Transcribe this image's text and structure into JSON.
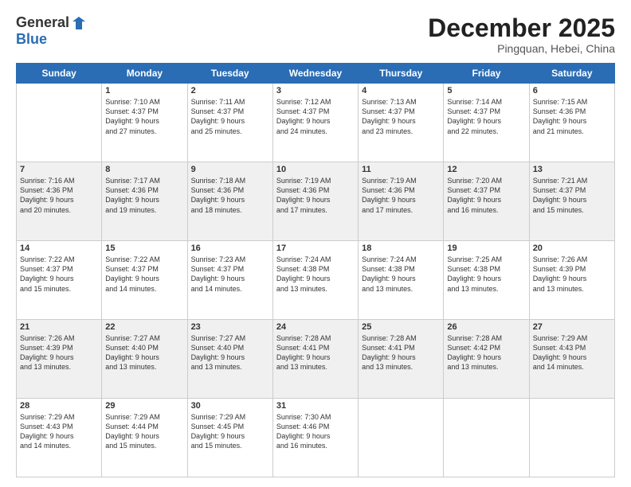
{
  "logo": {
    "general": "General",
    "blue": "Blue"
  },
  "header": {
    "month": "December 2025",
    "location": "Pingquan, Hebei, China"
  },
  "days_of_week": [
    "Sunday",
    "Monday",
    "Tuesday",
    "Wednesday",
    "Thursday",
    "Friday",
    "Saturday"
  ],
  "weeks": [
    [
      {
        "day": "",
        "content": ""
      },
      {
        "day": "1",
        "content": "Sunrise: 7:10 AM\nSunset: 4:37 PM\nDaylight: 9 hours\nand 27 minutes."
      },
      {
        "day": "2",
        "content": "Sunrise: 7:11 AM\nSunset: 4:37 PM\nDaylight: 9 hours\nand 25 minutes."
      },
      {
        "day": "3",
        "content": "Sunrise: 7:12 AM\nSunset: 4:37 PM\nDaylight: 9 hours\nand 24 minutes."
      },
      {
        "day": "4",
        "content": "Sunrise: 7:13 AM\nSunset: 4:37 PM\nDaylight: 9 hours\nand 23 minutes."
      },
      {
        "day": "5",
        "content": "Sunrise: 7:14 AM\nSunset: 4:37 PM\nDaylight: 9 hours\nand 22 minutes."
      },
      {
        "day": "6",
        "content": "Sunrise: 7:15 AM\nSunset: 4:36 PM\nDaylight: 9 hours\nand 21 minutes."
      }
    ],
    [
      {
        "day": "7",
        "content": "Sunrise: 7:16 AM\nSunset: 4:36 PM\nDaylight: 9 hours\nand 20 minutes."
      },
      {
        "day": "8",
        "content": "Sunrise: 7:17 AM\nSunset: 4:36 PM\nDaylight: 9 hours\nand 19 minutes."
      },
      {
        "day": "9",
        "content": "Sunrise: 7:18 AM\nSunset: 4:36 PM\nDaylight: 9 hours\nand 18 minutes."
      },
      {
        "day": "10",
        "content": "Sunrise: 7:19 AM\nSunset: 4:36 PM\nDaylight: 9 hours\nand 17 minutes."
      },
      {
        "day": "11",
        "content": "Sunrise: 7:19 AM\nSunset: 4:36 PM\nDaylight: 9 hours\nand 17 minutes."
      },
      {
        "day": "12",
        "content": "Sunrise: 7:20 AM\nSunset: 4:37 PM\nDaylight: 9 hours\nand 16 minutes."
      },
      {
        "day": "13",
        "content": "Sunrise: 7:21 AM\nSunset: 4:37 PM\nDaylight: 9 hours\nand 15 minutes."
      }
    ],
    [
      {
        "day": "14",
        "content": "Sunrise: 7:22 AM\nSunset: 4:37 PM\nDaylight: 9 hours\nand 15 minutes."
      },
      {
        "day": "15",
        "content": "Sunrise: 7:22 AM\nSunset: 4:37 PM\nDaylight: 9 hours\nand 14 minutes."
      },
      {
        "day": "16",
        "content": "Sunrise: 7:23 AM\nSunset: 4:37 PM\nDaylight: 9 hours\nand 14 minutes."
      },
      {
        "day": "17",
        "content": "Sunrise: 7:24 AM\nSunset: 4:38 PM\nDaylight: 9 hours\nand 13 minutes."
      },
      {
        "day": "18",
        "content": "Sunrise: 7:24 AM\nSunset: 4:38 PM\nDaylight: 9 hours\nand 13 minutes."
      },
      {
        "day": "19",
        "content": "Sunrise: 7:25 AM\nSunset: 4:38 PM\nDaylight: 9 hours\nand 13 minutes."
      },
      {
        "day": "20",
        "content": "Sunrise: 7:26 AM\nSunset: 4:39 PM\nDaylight: 9 hours\nand 13 minutes."
      }
    ],
    [
      {
        "day": "21",
        "content": "Sunrise: 7:26 AM\nSunset: 4:39 PM\nDaylight: 9 hours\nand 13 minutes."
      },
      {
        "day": "22",
        "content": "Sunrise: 7:27 AM\nSunset: 4:40 PM\nDaylight: 9 hours\nand 13 minutes."
      },
      {
        "day": "23",
        "content": "Sunrise: 7:27 AM\nSunset: 4:40 PM\nDaylight: 9 hours\nand 13 minutes."
      },
      {
        "day": "24",
        "content": "Sunrise: 7:28 AM\nSunset: 4:41 PM\nDaylight: 9 hours\nand 13 minutes."
      },
      {
        "day": "25",
        "content": "Sunrise: 7:28 AM\nSunset: 4:41 PM\nDaylight: 9 hours\nand 13 minutes."
      },
      {
        "day": "26",
        "content": "Sunrise: 7:28 AM\nSunset: 4:42 PM\nDaylight: 9 hours\nand 13 minutes."
      },
      {
        "day": "27",
        "content": "Sunrise: 7:29 AM\nSunset: 4:43 PM\nDaylight: 9 hours\nand 14 minutes."
      }
    ],
    [
      {
        "day": "28",
        "content": "Sunrise: 7:29 AM\nSunset: 4:43 PM\nDaylight: 9 hours\nand 14 minutes."
      },
      {
        "day": "29",
        "content": "Sunrise: 7:29 AM\nSunset: 4:44 PM\nDaylight: 9 hours\nand 15 minutes."
      },
      {
        "day": "30",
        "content": "Sunrise: 7:29 AM\nSunset: 4:45 PM\nDaylight: 9 hours\nand 15 minutes."
      },
      {
        "day": "31",
        "content": "Sunrise: 7:30 AM\nSunset: 4:46 PM\nDaylight: 9 hours\nand 16 minutes."
      },
      {
        "day": "",
        "content": ""
      },
      {
        "day": "",
        "content": ""
      },
      {
        "day": "",
        "content": ""
      }
    ]
  ]
}
